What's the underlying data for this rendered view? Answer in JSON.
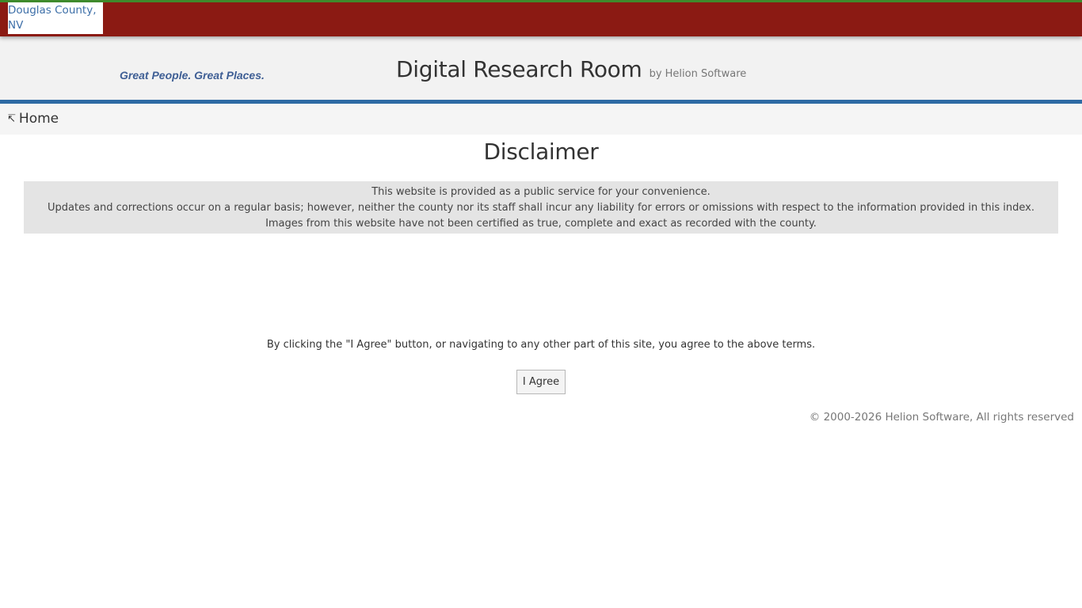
{
  "header": {
    "logo_alt": "Douglas County, NV",
    "tagline": "Great People. Great Places.",
    "title": "Digital Research Room",
    "by_line": "by Helion Software"
  },
  "nav": {
    "home_icon": "arrow-up-left-icon",
    "home_label": "Home"
  },
  "main": {
    "heading": "Disclaimer",
    "disclaimer_lines": [
      "This website is provided as a public service for your convenience.",
      "Updates and corrections occur on a regular basis; however, neither the county nor its staff shall incur any liability for errors or omissions with respect to the information provided in this index.",
      "Images from this website have not been certified as true, complete and exact as recorded with the county."
    ],
    "agree_text": "By clicking the \"I Agree\" button, or navigating to any other part of this site, you agree to the above terms.",
    "agree_button_label": "I Agree"
  },
  "footer": {
    "copyright": "© 2000-2026 Helion Software, All rights reserved"
  },
  "colors": {
    "topbar": "#8b1a13",
    "topbar_accent": "#3f8a2c",
    "rule_blue": "#2e6ba4",
    "tagline_blue": "#3f5f95"
  }
}
